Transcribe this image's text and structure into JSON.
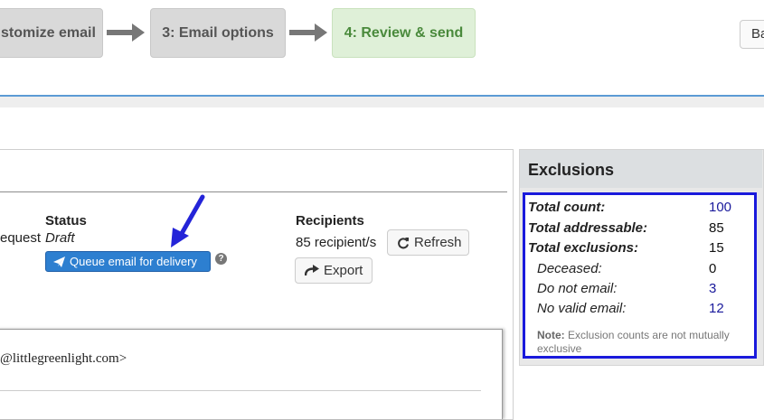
{
  "wizard": {
    "steps": [
      {
        "label": "stomize email"
      },
      {
        "label": "3: Email options"
      },
      {
        "label": "4: Review & send"
      }
    ],
    "back_label": "Ba"
  },
  "status": {
    "heading": "Status",
    "request_text": "equest",
    "value": "Draft",
    "queue_button": "Queue email for delivery",
    "help": "?"
  },
  "recipients": {
    "heading": "Recipients",
    "count_text": "85 recipient/s",
    "refresh_label": "Refresh",
    "export_label": "Export"
  },
  "preview": {
    "from_partial": "@littlegreenlight.com>"
  },
  "exclusions": {
    "title": "Exclusions",
    "rows": [
      {
        "label": "Total count:",
        "value": "100"
      },
      {
        "label": "Total addressable:",
        "value": "85"
      },
      {
        "label": "Total exclusions:",
        "value": "15"
      },
      {
        "label": "Deceased:",
        "value": "0"
      },
      {
        "label": "Do not email:",
        "value": "3"
      },
      {
        "label": "No valid email:",
        "value": "12"
      }
    ],
    "note_label": "Note:",
    "note_text": "Exclusion counts are not mutually exclusive"
  },
  "colors": {
    "active_step": "#dff0d8",
    "primary_button": "#2d7fd0",
    "highlight_border": "#1a1adc",
    "link": "#1a1a9c"
  }
}
